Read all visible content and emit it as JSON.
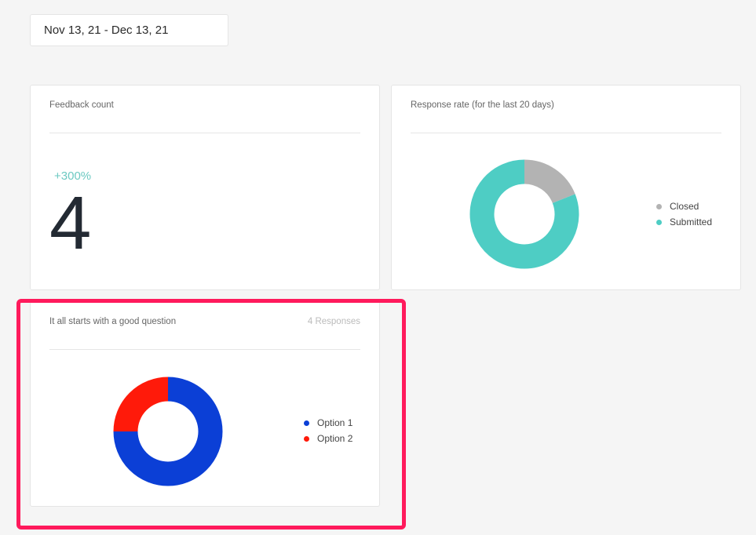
{
  "date_range": {
    "label": "Nov 13, 21 - Dec 13, 21"
  },
  "feedback_count": {
    "title": "Feedback count",
    "change": "+300%",
    "value": "4"
  },
  "response_rate": {
    "title": "Response rate (for the last 20 days)",
    "legend": [
      {
        "label": "Closed",
        "color": "#b3b3b3"
      },
      {
        "label": "Submitted",
        "color": "#4ecdc4"
      }
    ],
    "slices": [
      {
        "label": "Closed",
        "fraction": 0.19,
        "color": "#b3b3b3"
      },
      {
        "label": "Submitted",
        "fraction": 0.81,
        "color": "#4ecdc4"
      }
    ]
  },
  "question": {
    "title": "It all starts with a good question",
    "responses": "4 Responses",
    "legend": [
      {
        "label": "Option 1",
        "color": "#0b3fd6"
      },
      {
        "label": "Option 2",
        "color": "#ff1a0a"
      }
    ],
    "slices": [
      {
        "label": "Option 1",
        "fraction": 0.75,
        "color": "#0b3fd6"
      },
      {
        "label": "Option 2",
        "fraction": 0.25,
        "color": "#ff1a0a"
      }
    ]
  },
  "highlight_color": "#ff1a5c"
}
